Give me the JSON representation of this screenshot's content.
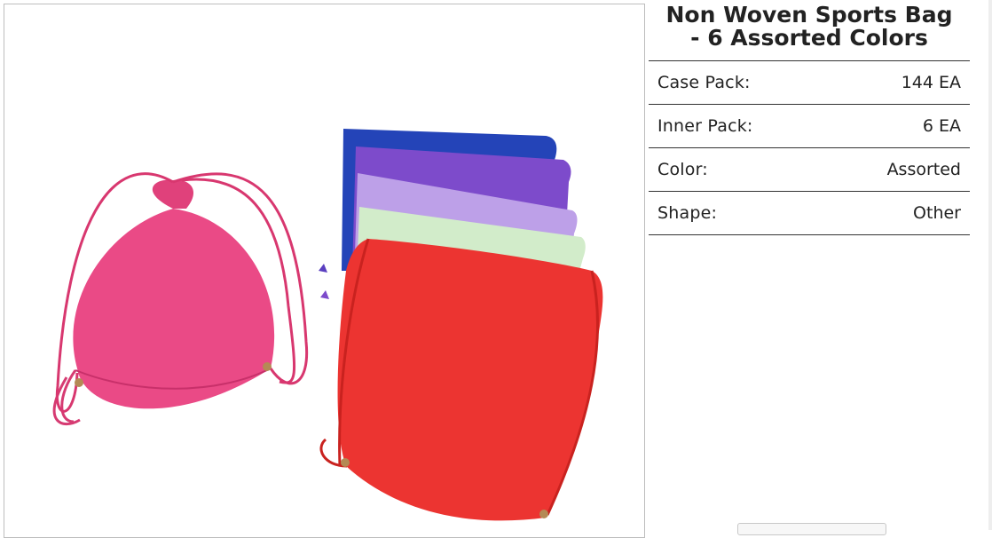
{
  "product": {
    "title_line1": "Non Woven Sports Bag",
    "title_line2": "- 6 Assorted Colors",
    "image": {
      "subject": "drawstring sports bags in assorted colors",
      "colors": [
        "#e8417f",
        "#1f3fb4",
        "#7b49c9",
        "#b99be6",
        "#cfe9c6",
        "#e8322e"
      ]
    },
    "specs": [
      {
        "label": "Case Pack:",
        "value": "144 EA"
      },
      {
        "label": "Inner Pack:",
        "value": "6 EA"
      },
      {
        "label": "Color:",
        "value": "Assorted"
      },
      {
        "label": "Shape:",
        "value": "Other"
      }
    ]
  }
}
